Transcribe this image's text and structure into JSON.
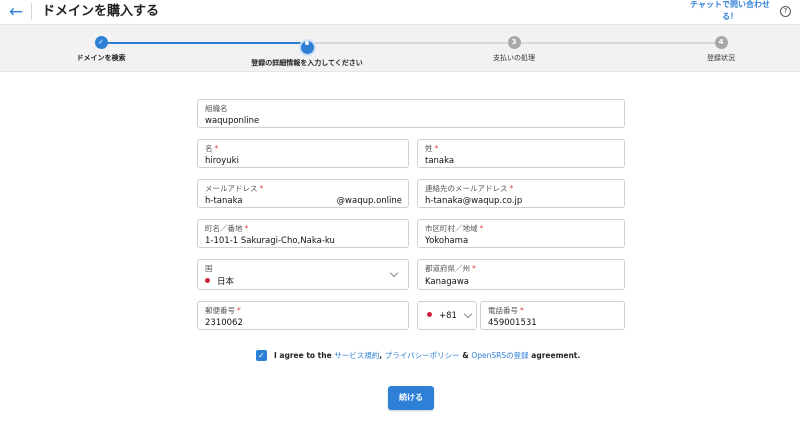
{
  "header": {
    "back_icon": "arrow-left-icon",
    "title": "ドメインを購入する",
    "chat_link": "チャットで問い合わせる！",
    "help_icon": "question-circle-icon"
  },
  "stepper": {
    "steps": [
      {
        "number": "✓",
        "label": "ドメインを検索",
        "state": "done"
      },
      {
        "number": "",
        "label": "登録の詳細情報を入力してください",
        "state": "active"
      },
      {
        "number": "3",
        "label": "支払いの処理",
        "state": "todo"
      },
      {
        "number": "4",
        "label": "登録状況",
        "state": "todo"
      }
    ]
  },
  "form": {
    "organization": {
      "label": "組織名",
      "value": "waquponline"
    },
    "first_name": {
      "label": "名",
      "value": "hiroyuki"
    },
    "last_name": {
      "label": "姓",
      "value": "tanaka"
    },
    "email": {
      "label": "メールアドレス",
      "value": "h-tanaka",
      "suffix": "@waqup.online"
    },
    "contact_email": {
      "label": "連絡先のメールアドレス",
      "value": "h-tanaka@waqup.co.jp"
    },
    "street": {
      "label": "町名／番地",
      "value": "1-101-1 Sakuragi-Cho,Naka-ku"
    },
    "city": {
      "label": "市区町村／地域",
      "value": "Yokohama"
    },
    "country": {
      "label": "国",
      "value": "日本"
    },
    "prefecture": {
      "label": "都道府県／州",
      "value": "Kanagawa"
    },
    "postal": {
      "label": "郵便番号",
      "value": "2310062"
    },
    "phone_code": {
      "value": "+81"
    },
    "phone": {
      "label": "電話番号",
      "value": "459001531"
    },
    "required_mark": "*"
  },
  "agreement": {
    "checked": true,
    "prefix": "I agree to the ",
    "link1": "サービス規約",
    "sep1": ", ",
    "link2": "プライバシーポリシー",
    "sep2": " & ",
    "link3": "OpenSRSの登録",
    "suffix": " agreement."
  },
  "continue_label": "続ける",
  "colors": {
    "accent": "#2e7fd6",
    "required": "#e04040",
    "flag": "#d0213a"
  }
}
